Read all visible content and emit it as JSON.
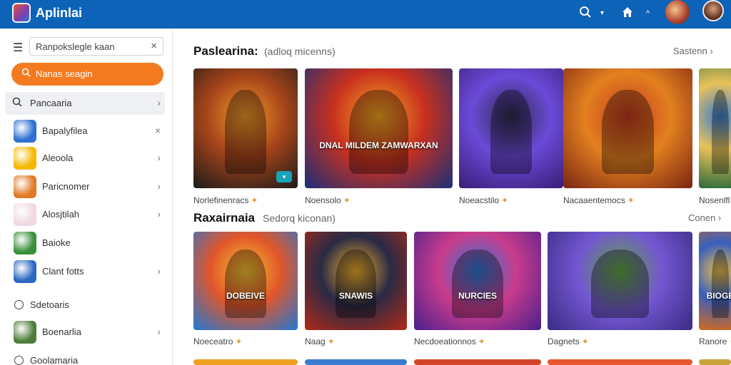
{
  "app": {
    "title": "Aplinlai"
  },
  "topbar": {
    "search_icon": "search-icon",
    "home_icon": "home-icon"
  },
  "sidebar": {
    "search": {
      "value": "Ranpokslegle kaan"
    },
    "cta_label": "Nanas seagin",
    "items": [
      {
        "label": "Pancaaria",
        "type": "nav",
        "trail": "›"
      },
      {
        "label": "Bapalyfilea",
        "type": "app",
        "trail": "×",
        "color": "#2d6fd3"
      },
      {
        "label": "Aleoola",
        "type": "app",
        "trail": "›",
        "color": "#f5b800"
      },
      {
        "label": "Paricnomer",
        "type": "app",
        "trail": "›",
        "color": "#e07a24"
      },
      {
        "label": "Alosjtilah",
        "type": "app",
        "trail": "›",
        "color": "#f0d8e2"
      },
      {
        "label": "Baioke",
        "type": "app",
        "trail": "",
        "color": "#3a8f3a"
      },
      {
        "label": "Clant fotts",
        "type": "app",
        "trail": "›",
        "color": "#2b68c2"
      },
      {
        "label": "Sdetoaris",
        "type": "radio",
        "trail": ""
      },
      {
        "label": "Boenarlia",
        "type": "app",
        "trail": "›",
        "color": "#4e7d3a"
      },
      {
        "label": "Goolamaria",
        "type": "radio",
        "trail": ""
      }
    ]
  },
  "main": {
    "sections": [
      {
        "title": "Paslearina:",
        "subtitle": "(adloq micenns)",
        "see_more": "Sastenn",
        "cards": [
          {
            "title": "",
            "caption": "Norlefinenracs",
            "badge": "▾",
            "colors": [
              "#1b1b1b",
              "#a6441a",
              "#f19a2a"
            ]
          },
          {
            "title": "DNAL MILDEM ZAMWARXAN",
            "caption": "Noensolo",
            "badge": "",
            "colors": [
              "#1a2e78",
              "#c8301f",
              "#f6a821"
            ]
          },
          {
            "title": "",
            "caption": "Noeacstilo",
            "badge": "",
            "colors": [
              "#3a1d77",
              "#6b4ad8",
              "#2d2a4a"
            ]
          },
          {
            "title": "",
            "caption": "Nacaaentemocs",
            "badge": "",
            "colors": [
              "#7a2412",
              "#e3801f",
              "#c43a1f"
            ]
          },
          {
            "title": "",
            "caption": "Nosenlfl",
            "badge": "",
            "colors": [
              "#2b6a3b",
              "#e9c25a",
              "#3b7bd0"
            ]
          }
        ]
      },
      {
        "title": "Raxairnaia",
        "subtitle": "Sedorq kiconan)",
        "see_more": "Conen",
        "cards": [
          {
            "title": "DOBEIVE",
            "caption": "Noeceatro",
            "badge": "",
            "colors": [
              "#1f78d4",
              "#e1562a",
              "#f6c331"
            ]
          },
          {
            "title": "SNAWIS",
            "caption": "Naag",
            "badge": "",
            "colors": [
              "#b12a17",
              "#2a2a45",
              "#f4b12e"
            ]
          },
          {
            "title": "NURCIES",
            "caption": "Necdoeationnos",
            "badge": "",
            "colors": [
              "#4a1f8c",
              "#c93c8c",
              "#2d78d6"
            ]
          },
          {
            "title": "",
            "caption": "Dagnets",
            "badge": "",
            "colors": [
              "#3a2a83",
              "#7357d1",
              "#5fa640"
            ]
          },
          {
            "title": "BIOGE",
            "caption": "Ranore",
            "badge": "",
            "colors": [
              "#d26a1c",
              "#3a5fbf",
              "#f0c040"
            ]
          }
        ]
      }
    ]
  }
}
